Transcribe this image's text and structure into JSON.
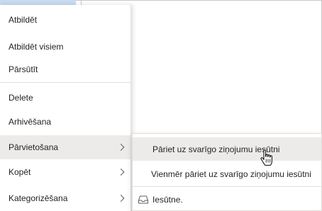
{
  "context_menu": {
    "items": [
      {
        "label": "Atbildēt"
      },
      {
        "label": "Atbildēt visiem"
      },
      {
        "label": "Pārsūtīt"
      },
      {
        "label": "Delete"
      },
      {
        "label": "Arhivēšana"
      },
      {
        "label": "Pārvietošana"
      },
      {
        "label": "Kopēt"
      },
      {
        "label": "Kategorizēšana"
      }
    ]
  },
  "submenu": {
    "items": [
      {
        "label": "Pāriet uz svarīgo ziņojumu iesūtni"
      },
      {
        "label": "Vienmēr pāriet uz svarīgo ziņojumu iesūtni"
      },
      {
        "label": "Iesūtne."
      }
    ]
  },
  "icons": {
    "chevron": "chevron-right-icon",
    "folder": "inbox-tray-icon",
    "cursor": "hand-pointer-icon"
  }
}
